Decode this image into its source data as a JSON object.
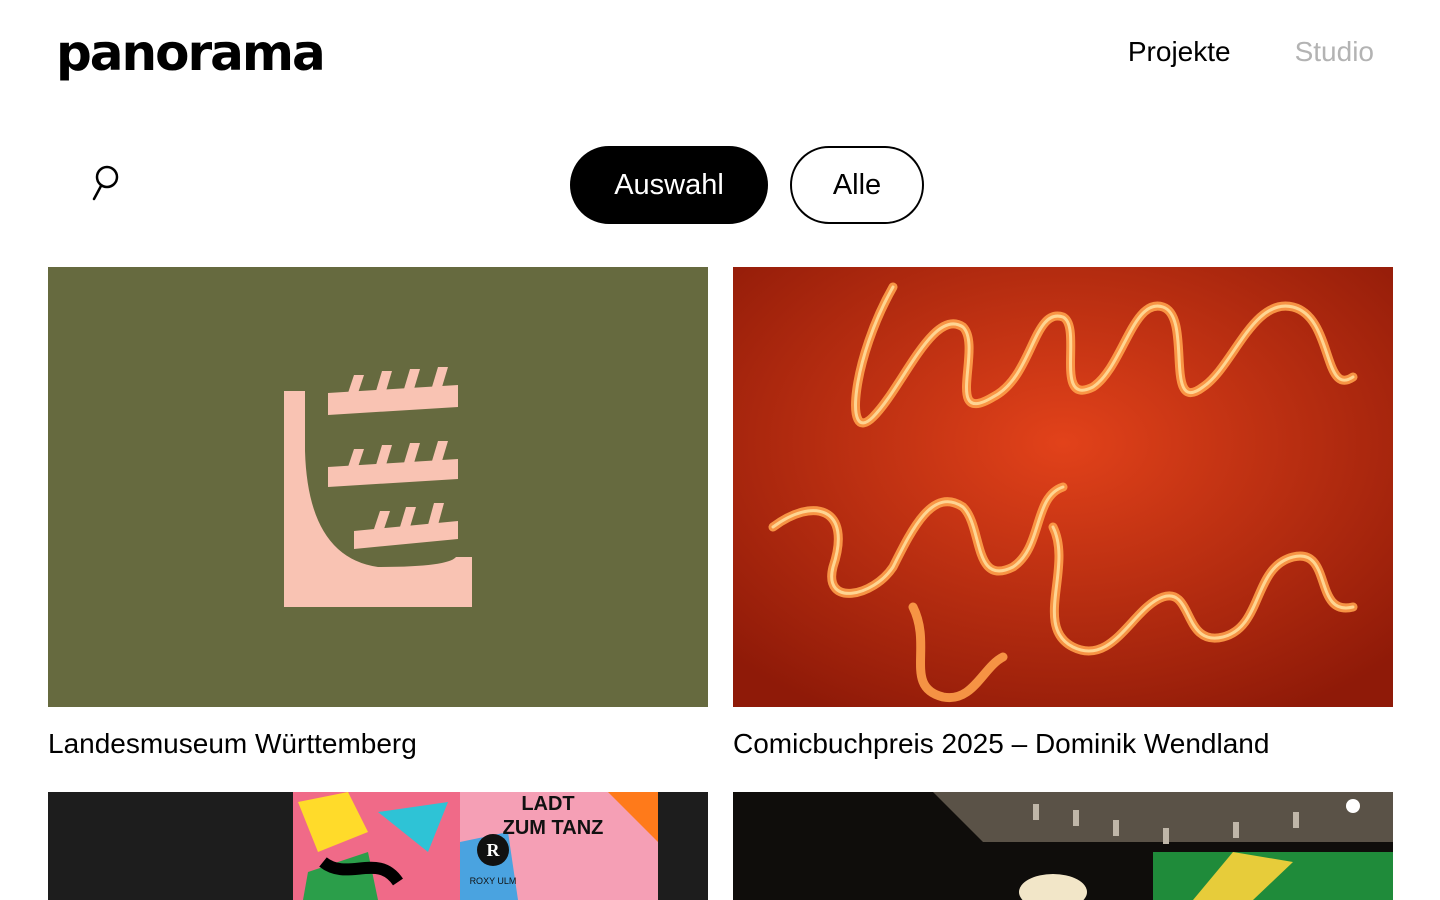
{
  "header": {
    "logo": "panorama",
    "nav": [
      {
        "label": "Projekte",
        "active": true
      },
      {
        "label": "Studio",
        "active": false
      }
    ]
  },
  "search": {
    "icon": "search-icon"
  },
  "filters": [
    {
      "label": "Auswahl",
      "selected": true
    },
    {
      "label": "Alle",
      "selected": false
    }
  ],
  "projects": [
    {
      "title": "Landesmuseum Württemberg",
      "image": "olive background with pink stag-antler logo"
    },
    {
      "title": "Comicbuchpreis 2025 – Dominik Wendland",
      "image": "orange neon lettering"
    },
    {
      "title": "",
      "image": "colorful ZUM TANZ posters"
    },
    {
      "title": "",
      "image": "exhibition hall with spotlights"
    }
  ],
  "poster_text": {
    "line1": "LADT",
    "line2": "ZUM TANZ",
    "badge": "R",
    "sub": "ROXY ULM"
  },
  "colors": {
    "olive": "#666a3f",
    "pink": "#f9c3b3",
    "neon": "#ff6a1a",
    "inactive_nav": "#b3b3b3"
  }
}
